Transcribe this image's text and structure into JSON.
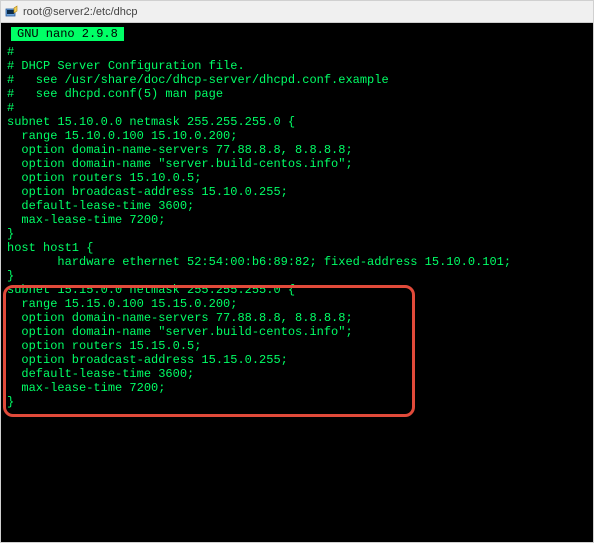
{
  "titlebar": {
    "title": "root@server2:/etc/dhcp"
  },
  "editor": {
    "header": " GNU nano 2.9.8 "
  },
  "lines": {
    "l0": "#",
    "l1": "# DHCP Server Configuration file.",
    "l2": "#   see /usr/share/doc/dhcp-server/dhcpd.conf.example",
    "l3": "#   see dhcpd.conf(5) man page",
    "l4": "#",
    "l5": "subnet 15.10.0.0 netmask 255.255.255.0 {",
    "l6": "  range 15.10.0.100 15.10.0.200;",
    "l7": "  option domain-name-servers 77.88.8.8, 8.8.8.8;",
    "l8": "  option domain-name \"server.build-centos.info\";",
    "l9": "  option routers 15.10.0.5;",
    "l10": "  option broadcast-address 15.10.0.255;",
    "l11": "  default-lease-time 3600;",
    "l12": "  max-lease-time 7200;",
    "l13": "}",
    "l14": "host host1 {",
    "l15": "       hardware ethernet 52:54:00:b6:89:82; fixed-address 15.10.0.101;",
    "l16": "}",
    "l17": "",
    "l18": "subnet 15.15.0.0 netmask 255.255.255.0 {",
    "l19": "  range 15.15.0.100 15.15.0.200;",
    "l20": "  option domain-name-servers 77.88.8.8, 8.8.8.8;",
    "l21": "  option domain-name \"server.build-centos.info\";",
    "l22": "  option routers 15.15.0.5;",
    "l23": "  option broadcast-address 15.15.0.255;",
    "l24": "  default-lease-time 3600;",
    "l25": "  max-lease-time 7200;",
    "l26": "}"
  },
  "highlight": {
    "color": "#e14a3a"
  }
}
